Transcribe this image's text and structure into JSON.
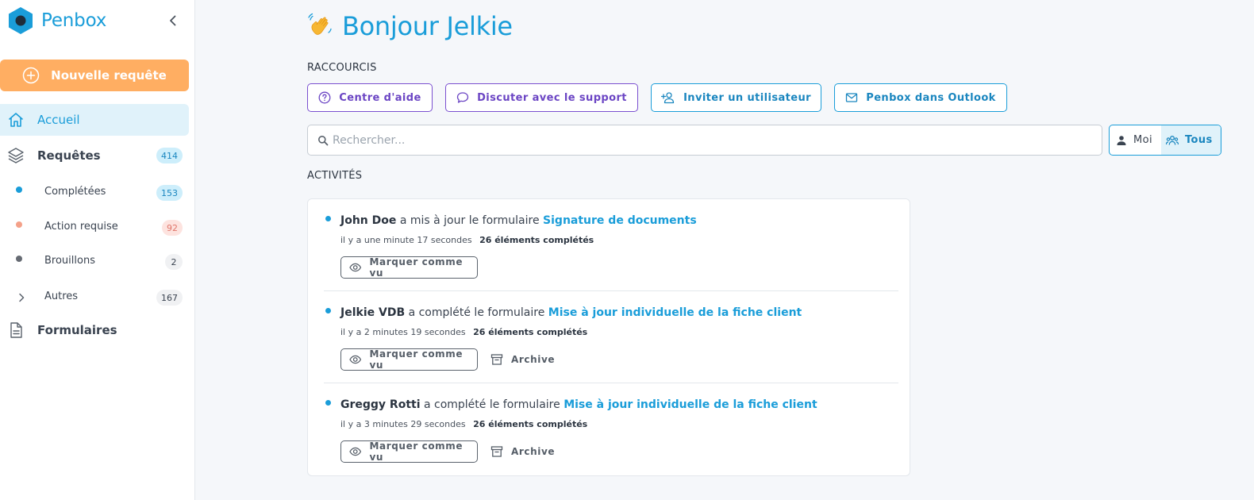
{
  "brand": {
    "name": "Penbox",
    "color": "#1a9dd9"
  },
  "sidebar": {
    "new_request_label": "Nouvelle requête",
    "home_label": "Accueil",
    "requests": {
      "label": "Requêtes",
      "count": "414"
    },
    "sub_items": [
      {
        "label": "Complétées",
        "count": "153",
        "dot_color": "#1a9dd9"
      },
      {
        "label": "Action requise",
        "count": "92",
        "dot_color": "#f4a189"
      },
      {
        "label": "Brouillons",
        "count": "2",
        "dot_color": "#666b73"
      },
      {
        "label": "Autres",
        "count": "167"
      }
    ],
    "forms_label": "Formulaires"
  },
  "main": {
    "greeting": "Bonjour Jelkie",
    "shortcuts_title": "RACCOURCIS",
    "shortcuts": [
      {
        "label": "Centre d'aide",
        "icon": "help-circle-icon"
      },
      {
        "label": "Discuter avec le support",
        "icon": "chat-bubble-icon"
      },
      {
        "label": "Inviter un utilisateur",
        "icon": "user-plus-icon"
      },
      {
        "label": "Penbox dans Outlook",
        "icon": "mail-icon"
      }
    ],
    "search": {
      "placeholder": "Rechercher...",
      "value": ""
    },
    "filter": {
      "me_label": "Moi",
      "all_label": "Tous",
      "selected": "Tous"
    },
    "activities_title": "ACTIVITÉS",
    "activities": [
      {
        "user": "John Doe",
        "action": "a mis à jour le formulaire",
        "form": "Signature de documents",
        "time": "il y a une minute 17 secondes",
        "completed": "26 éléments complétés",
        "mark_label": "Marquer comme vu",
        "archive_label": ""
      },
      {
        "user": "Jelkie VDB",
        "action": "a complété le formulaire",
        "form": "Mise à jour individuelle de la fiche client",
        "time": "il y a 2 minutes 19 secondes",
        "completed": "26 éléments complétés",
        "mark_label": "Marquer comme vu",
        "archive_label": "Archive"
      },
      {
        "user": "Greggy Rotti",
        "action": "a complété le formulaire",
        "form": "Mise à jour individuelle de la fiche client",
        "time": "il y a 3 minutes 29 secondes",
        "completed": "26 éléments complétés",
        "mark_label": "Marquer comme vu",
        "archive_label": "Archive"
      }
    ]
  },
  "colors": {
    "accent": "#1a9dd9",
    "orange": "#ffae62",
    "purple": "#6b45c4"
  }
}
